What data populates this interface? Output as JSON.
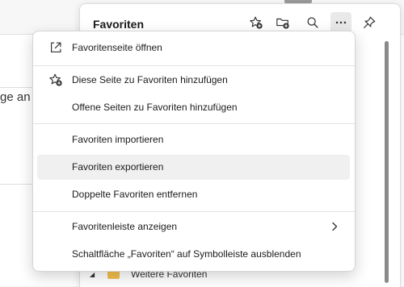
{
  "background": {
    "text_fragment": "ge an"
  },
  "favorites_panel": {
    "title": "Favoriten",
    "toolbar_icons": [
      "add-favorite-icon",
      "add-folder-icon",
      "search-icon",
      "more-icon",
      "pin-icon"
    ],
    "tree": [
      {
        "label": "Weitere Favoriten",
        "icon": "folder-icon",
        "expanded": false
      }
    ]
  },
  "menu": {
    "items": [
      {
        "label": "Favoritenseite öffnen",
        "icon": "open-external-icon"
      },
      {
        "label": "Diese Seite zu Favoriten hinzufügen",
        "icon": "add-favorite-icon"
      },
      {
        "label": "Offene Seiten zu Favoriten hinzufügen",
        "icon": ""
      },
      {
        "label": "Favoriten importieren",
        "icon": ""
      },
      {
        "label": "Favoriten exportieren",
        "icon": "",
        "hovered": true
      },
      {
        "label": "Doppelte Favoriten entfernen",
        "icon": ""
      },
      {
        "label": "Favoritenleiste anzeigen",
        "icon": "",
        "submenu": true
      },
      {
        "label": "Schaltfläche „Favoriten“ auf Symbolleiste ausblenden",
        "icon": ""
      }
    ]
  }
}
